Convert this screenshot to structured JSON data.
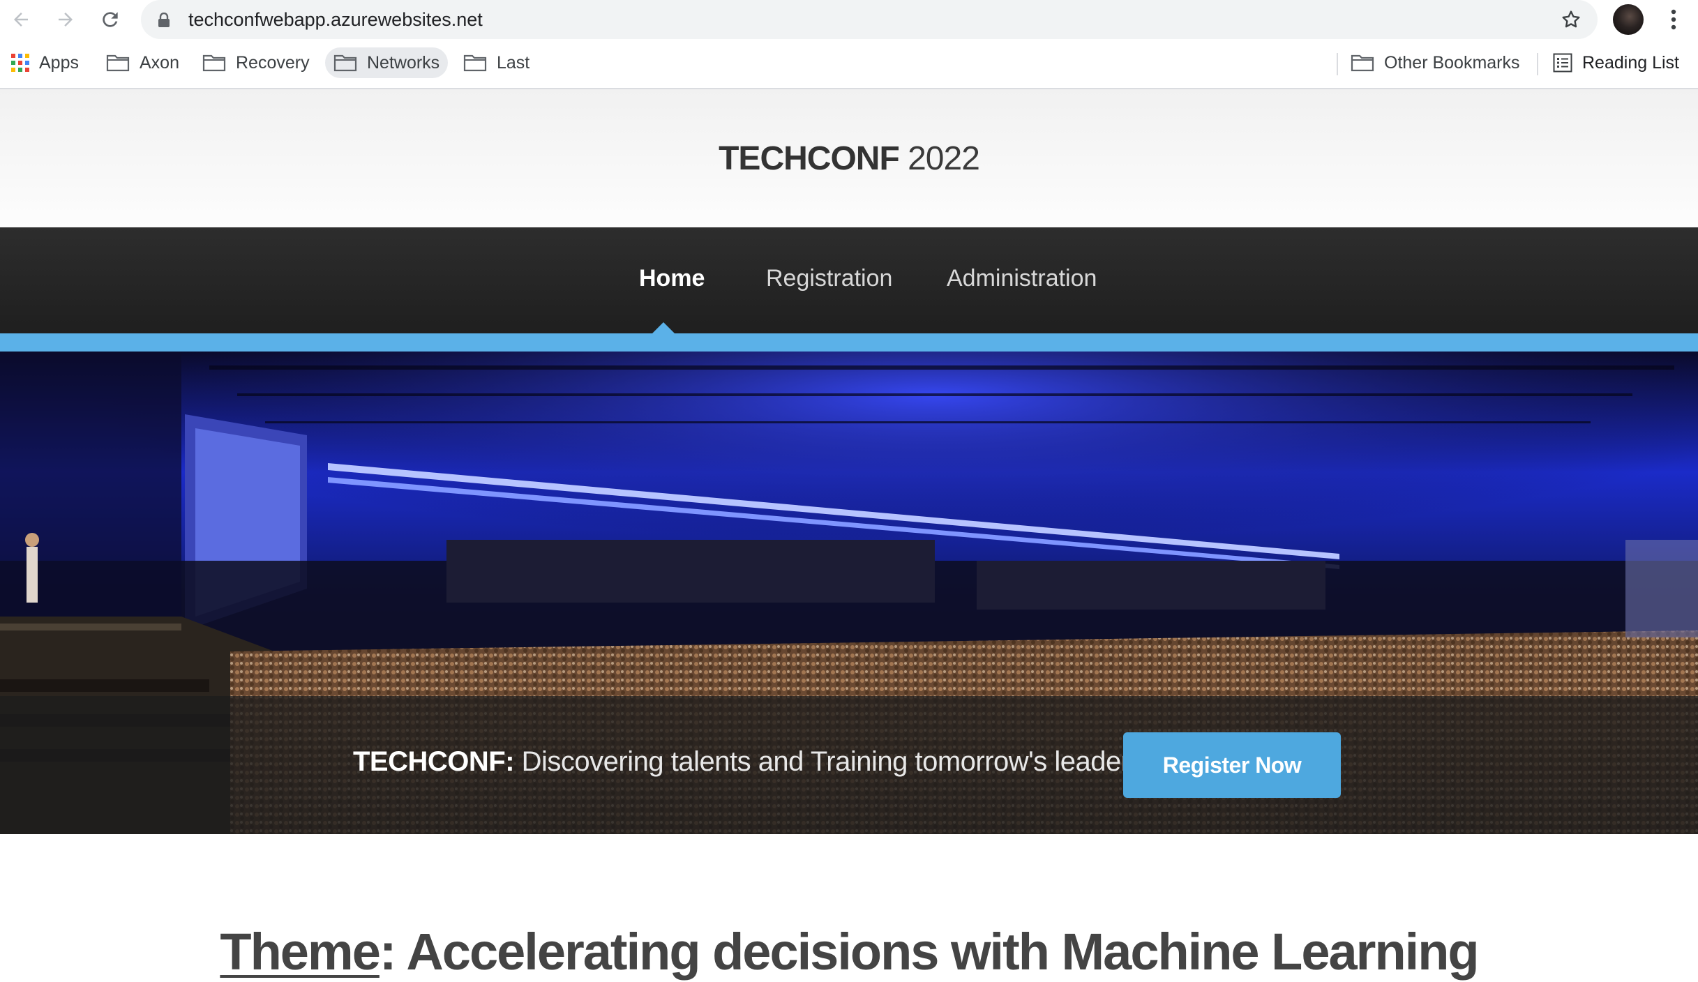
{
  "browser": {
    "url": "techconfwebapp.azurewebsites.net",
    "bookmarks": [
      {
        "label": "Apps",
        "icon": "apps-grid-icon"
      },
      {
        "label": "Axon",
        "icon": "folder-icon"
      },
      {
        "label": "Recovery",
        "icon": "folder-icon"
      },
      {
        "label": "Networks",
        "icon": "folder-icon"
      },
      {
        "label": "Last",
        "icon": "folder-icon"
      }
    ],
    "other_bookmarks": "Other Bookmarks",
    "reading_list": "Reading List"
  },
  "site": {
    "logo_bold": "TECHCONF",
    "logo_year": " 2022",
    "nav": {
      "home": "Home",
      "registration": "Registration",
      "administration": "Administration"
    },
    "hero": {
      "tagline_bold": "TECHCONF:",
      "tagline_rest": " Discovering talents and Training tomorrow's leaders",
      "register_label": "Register Now"
    },
    "theme": {
      "label": "Theme",
      "text": ": Accelerating decisions with Machine Learning"
    }
  },
  "colors": {
    "accent": "#5bb1e8",
    "button": "#4ea8df",
    "nav_bg": "#262626"
  }
}
